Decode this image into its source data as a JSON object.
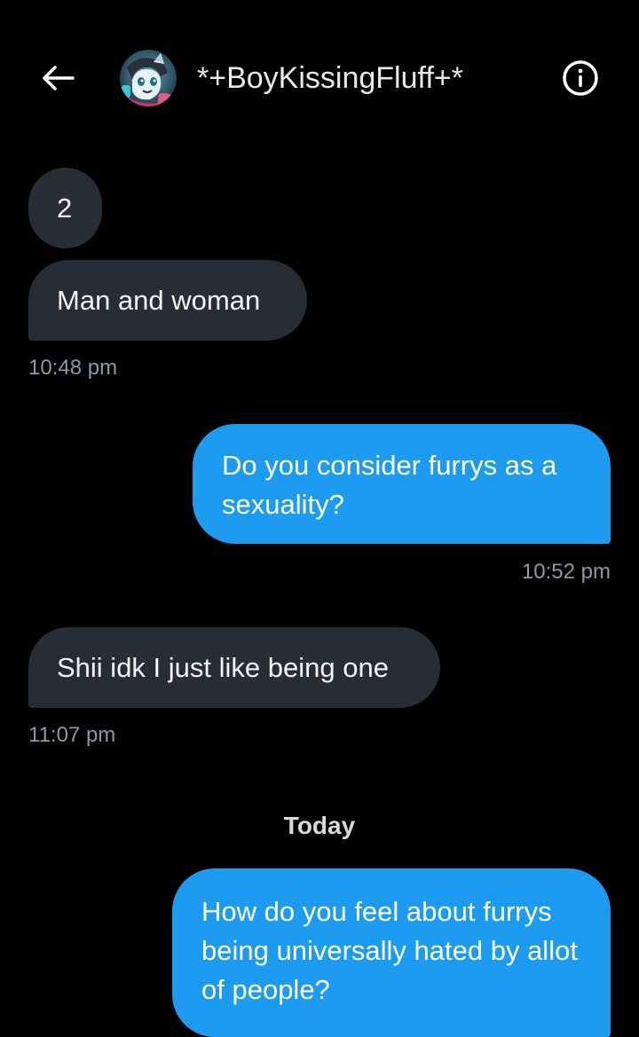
{
  "header": {
    "contact_name": "*+BoyKissingFluff+*",
    "back_icon": "arrow-left-icon",
    "info_icon": "info-circle-icon"
  },
  "messages": [
    {
      "text": "2",
      "side": "received"
    },
    {
      "text": "Man and woman",
      "side": "received"
    },
    {
      "time": "10:48 pm"
    },
    {
      "text": "Do you consider furrys as a sexuality?",
      "side": "sent"
    },
    {
      "time": "10:52 pm"
    },
    {
      "text": "Shii idk I just like being one",
      "side": "received"
    },
    {
      "time": "11:07 pm"
    },
    {
      "separator": "Today"
    },
    {
      "text": "How do you feel about furrys being universally hated by allot of people?",
      "side": "sent"
    }
  ],
  "colors": {
    "background": "#000000",
    "received_bubble": "#262d34",
    "sent_bubble": "#1d9bf0",
    "timestamp": "#8b98a5"
  }
}
